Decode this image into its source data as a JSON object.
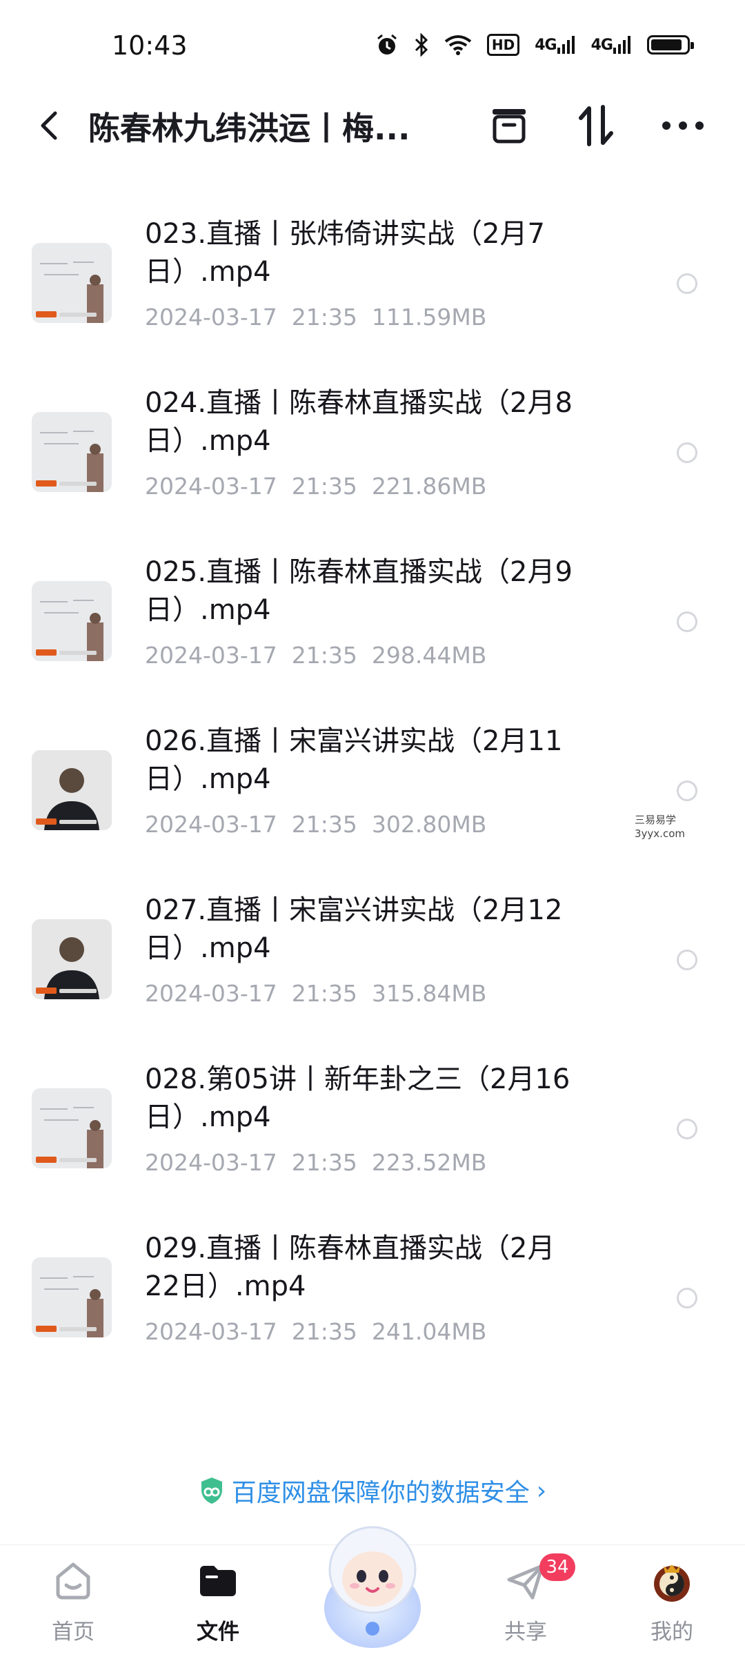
{
  "status_bar": {
    "time": "10:43",
    "hd": "HD",
    "net1": "4G",
    "net2": "4G"
  },
  "header": {
    "title": "陈春林九纬洪运丨梅..."
  },
  "files": [
    {
      "name": "023.直播丨张炜倚讲实战（2月7日）.mp4",
      "date": "2024-03-17  21:35",
      "size": "111.59MB",
      "thumb": "slide"
    },
    {
      "name": "024.直播丨陈春林直播实战（2月8日）.mp4",
      "date": "2024-03-17  21:35",
      "size": "221.86MB",
      "thumb": "board"
    },
    {
      "name": "025.直播丨陈春林直播实战（2月9日）.mp4",
      "date": "2024-03-17  21:35",
      "size": "298.44MB",
      "thumb": "board"
    },
    {
      "name": "026.直播丨宋富兴讲实战（2月11日）.mp4",
      "date": "2024-03-17  21:35",
      "size": "302.80MB",
      "thumb": "person"
    },
    {
      "name": "027.直播丨宋富兴讲实战（2月12日）.mp4",
      "date": "2024-03-17  21:35",
      "size": "315.84MB",
      "thumb": "person"
    },
    {
      "name": "028.第05讲丨新年卦之三（2月16日）.mp4",
      "date": "2024-03-17  21:35",
      "size": "223.52MB",
      "thumb": "board"
    },
    {
      "name": "029.直播丨陈春林直播实战（2月22日）.mp4",
      "date": "2024-03-17  21:35",
      "size": "241.04MB",
      "thumb": "board"
    }
  ],
  "watermark": {
    "line1": "三易易学",
    "line2": "3yyx.com"
  },
  "banner": {
    "text": "百度网盘保障你的数据安全",
    "chevron": "›"
  },
  "nav": {
    "home": "首页",
    "files": "文件",
    "share": "共享",
    "share_badge": "34",
    "mine": "我的"
  },
  "icons": {
    "back": "chevron-left-icon",
    "archive": "archive-icon",
    "sort": "sort-icon",
    "more": "more-icon",
    "shield": "shield-icon"
  },
  "colors": {
    "accent": "#2f8fe6",
    "badge": "#f23d5e",
    "meta": "#a5a8b0"
  }
}
